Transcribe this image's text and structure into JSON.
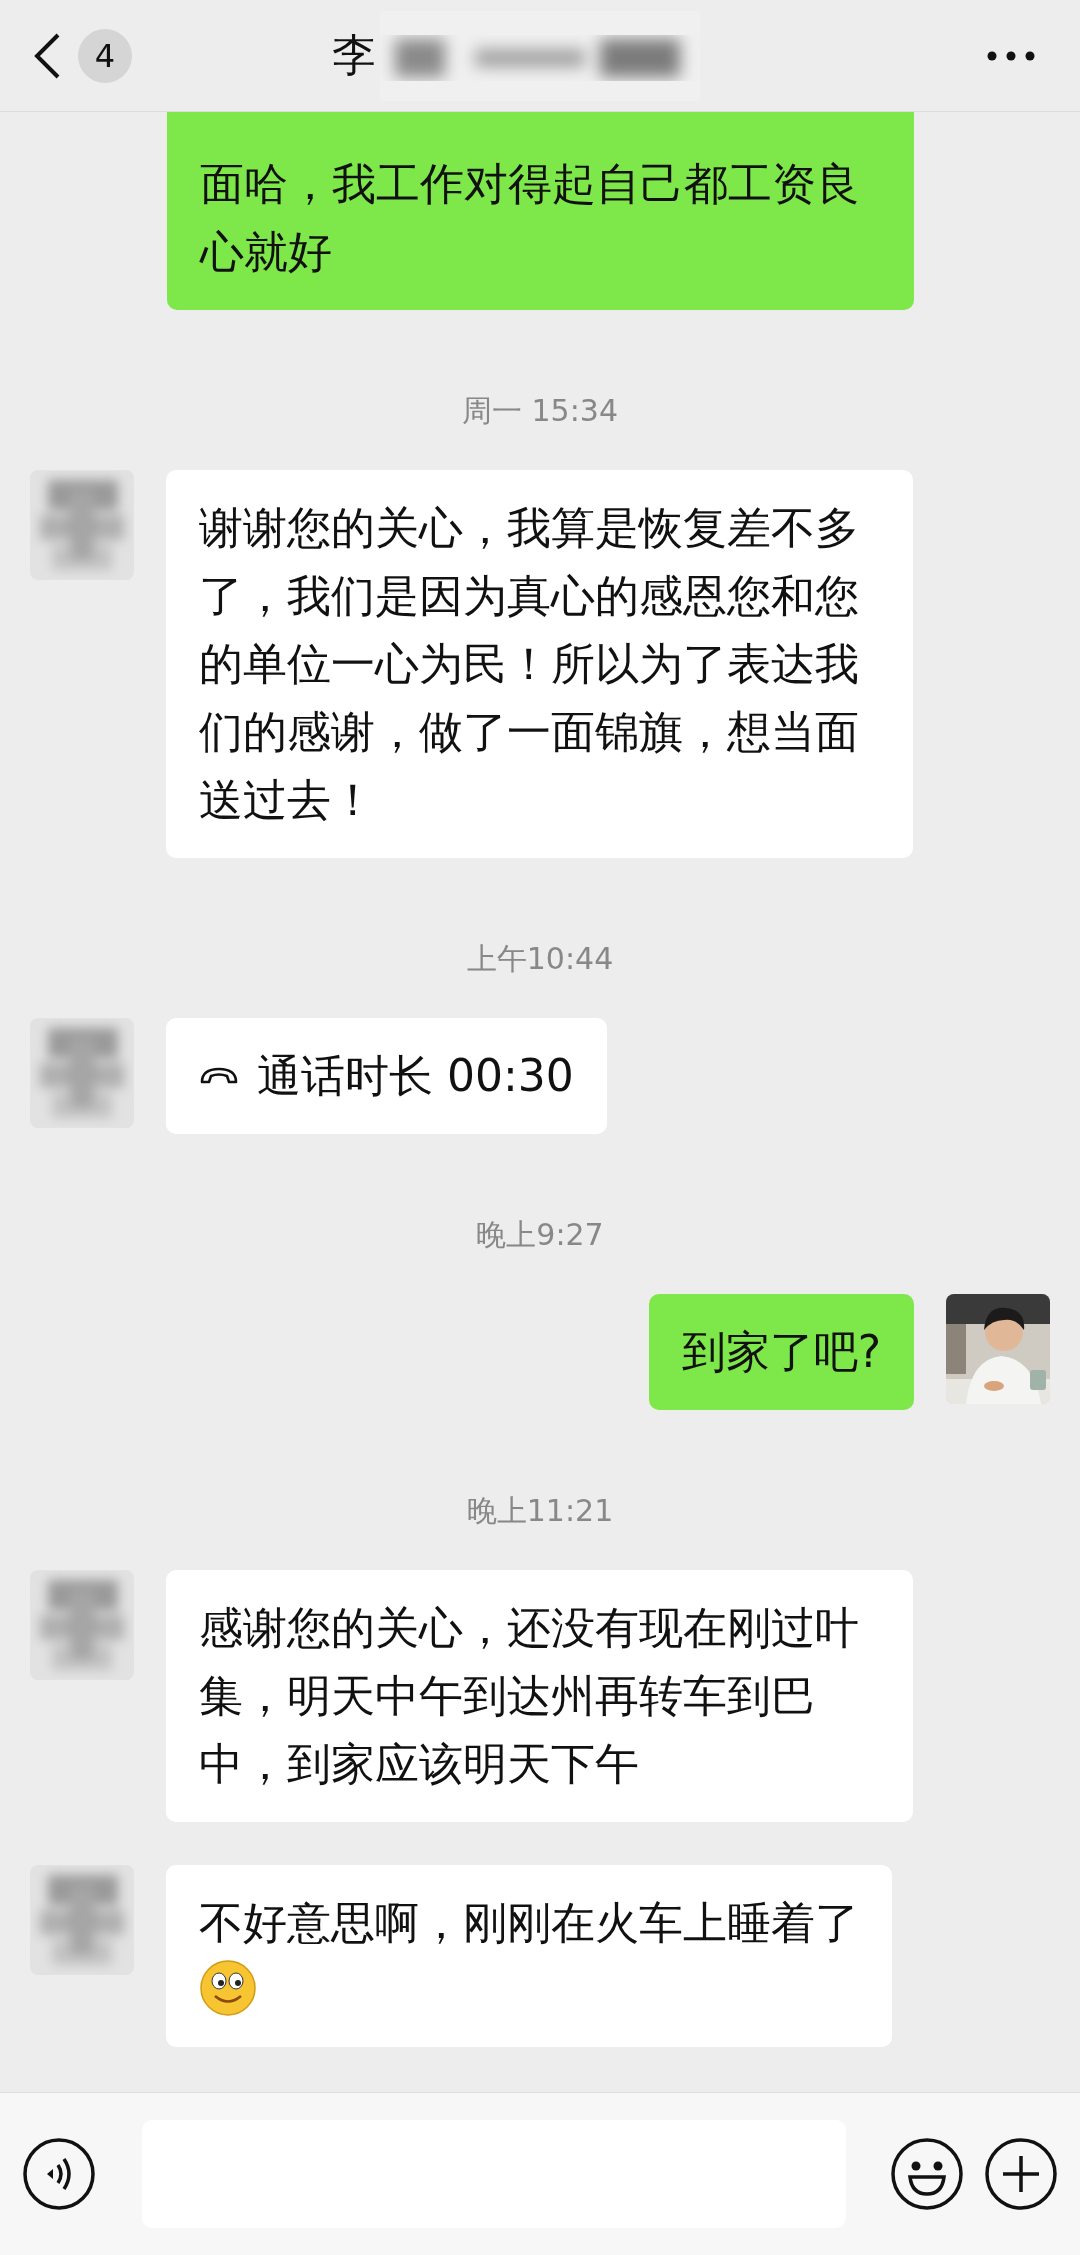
{
  "header": {
    "back_badge": "4",
    "title": "李"
  },
  "messages": [
    {
      "kind": "sent",
      "cut_top": true,
      "text": "面哈，我工作对得起自己都工资良心就好"
    },
    {
      "kind": "time",
      "text": "周一 15:34"
    },
    {
      "kind": "received",
      "text": "谢谢您的关心，我算是恢复差不多了，我们是因为真心的感恩您和您的单位一心为民！所以为了表达我们的感谢，做了一面锦旗，想当面送过去！"
    },
    {
      "kind": "time",
      "text": "上午10:44"
    },
    {
      "kind": "call",
      "text": "通话时长 00:30"
    },
    {
      "kind": "time",
      "text": "晚上9:27"
    },
    {
      "kind": "sent",
      "text": "到家了吧?"
    },
    {
      "kind": "time",
      "text": "晚上11:21"
    },
    {
      "kind": "received",
      "text": "感谢您的关心，还没有现在刚过叶集，明天中午到达州再转车到巴中，到家应该明天下午"
    },
    {
      "kind": "received",
      "emoji": true,
      "text": "不好意思啊，刚刚在火车上睡着了"
    }
  ]
}
